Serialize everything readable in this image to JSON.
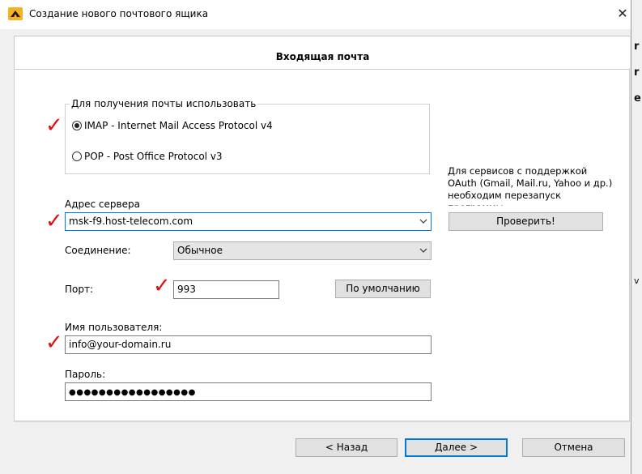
{
  "window": {
    "title": "Создание нового почтового ящика",
    "close_glyph": "✕"
  },
  "header": {
    "title": "Входящая почта"
  },
  "protocol_group": {
    "legend": "Для получения почты использовать",
    "imap_label": "IMAP - Internet Mail Access Protocol v4",
    "pop_label": "POP  -  Post Office Protocol v3",
    "selected": "IMAP"
  },
  "server": {
    "label": "Адрес сервера",
    "value": "msk-f9.host-telecom.com"
  },
  "connection": {
    "label": "Соединение:",
    "value": "Обычное"
  },
  "port": {
    "label": "Порт:",
    "value": "993",
    "default_button": "По умолчанию"
  },
  "username": {
    "label": "Имя пользователя:",
    "value": "info@your-domain.ru"
  },
  "password": {
    "label": "Пароль:",
    "value": "●●●●●●●●●●●●●●●●●"
  },
  "oauth": {
    "note": "Для сервисов с поддержкой OAuth (Gmail, Mail.ru, Yahoo и др.) необходим перезапуск программы",
    "check_button": "Проверить!"
  },
  "footer": {
    "back_button": "<  Назад",
    "next_button": "Далее  >",
    "cancel_button": "Отмена"
  },
  "annotations": {
    "checkmark_glyph": "✓",
    "checkmark_color": "#e01010"
  },
  "background_window": {
    "marks": [
      "r",
      "r",
      "e",
      "v"
    ]
  },
  "colors": {
    "accent": "#0078d7",
    "dialog_bg": "#f0f0f0"
  }
}
